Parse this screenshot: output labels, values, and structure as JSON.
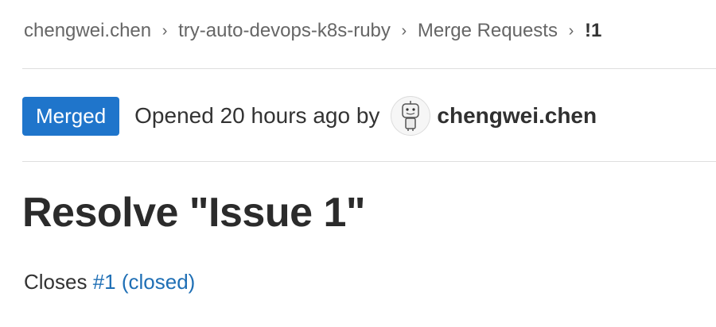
{
  "breadcrumb": {
    "items": [
      "chengwei.chen",
      "try-auto-devops-k8s-ruby",
      "Merge Requests"
    ],
    "current": "!1"
  },
  "merge_request": {
    "status": "Merged",
    "status_color": "#1f75cb",
    "opened_text": "Opened 20 hours ago by",
    "author": "chengwei.chen",
    "title": "Resolve \"Issue 1\"",
    "description": {
      "prefix": "Closes",
      "issue_link": "#1 (closed)"
    }
  },
  "icons": {
    "separator": "chevron-right-icon",
    "avatar": "robot-avatar-icon"
  },
  "colors": {
    "link": "#1f6fb5",
    "text": "#303030",
    "muted": "#666666"
  }
}
